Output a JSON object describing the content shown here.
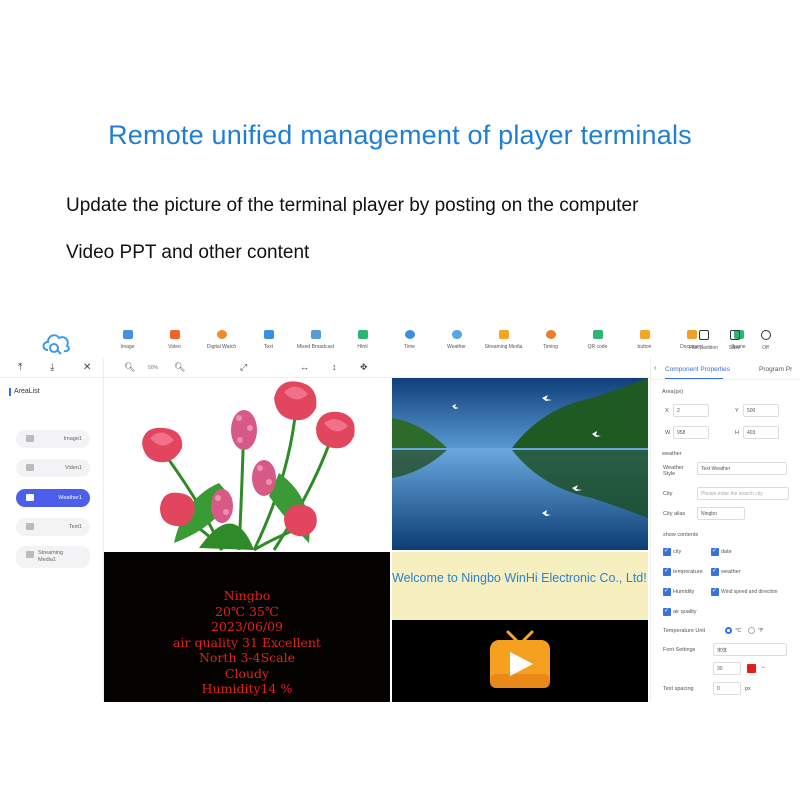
{
  "headline": "Remote unified management of player terminals",
  "subline1": "Update the picture of the terminal player by posting on the computer",
  "subline2": "Video PPT and other content",
  "toolbar": {
    "tools": [
      {
        "label": "Image",
        "color": "#4a90e2"
      },
      {
        "label": "Video",
        "color": "#f0632a"
      },
      {
        "label": "Digital Watch",
        "color": "#f08a2a"
      },
      {
        "label": "Text",
        "color": "#3a8fe0"
      },
      {
        "label": "Mixed Broadcast",
        "color": "#5b9bd5"
      },
      {
        "label": "Html",
        "color": "#2bb673"
      },
      {
        "label": "Time",
        "color": "#3a8fe0"
      },
      {
        "label": "Weather",
        "color": "#58a6e8"
      },
      {
        "label": "Streaming Media",
        "color": "#f5a623"
      },
      {
        "label": "Timing",
        "color": "#f07c2a"
      },
      {
        "label": "QR code",
        "color": "#2bb673"
      },
      {
        "label": "button",
        "color": "#f5a623"
      },
      {
        "label": "Document",
        "color": "#f0a02a"
      },
      {
        "label": "Iframe",
        "color": "#2bb673"
      }
    ],
    "fast_partition": "Fast partition",
    "save": "Save",
    "off": "Off"
  },
  "canvas_toolbar": {
    "zoom": "50%"
  },
  "area_list": {
    "title": "AreaList",
    "items": [
      "Image1",
      "Video1",
      "Weather1",
      "Text1",
      "Streaming Media1"
    ],
    "active_index": 2
  },
  "weather_lines": [
    "Ningbo",
    "20℃ 35℃",
    "2023/06/09",
    "air quality 31 Excellent",
    "North 3-4Scale",
    "Cloudy",
    "Humidity14 %"
  ],
  "welcome_text": "Welcome to Ningbo WinHi Electronic Co., Ltd!",
  "panel": {
    "tabs": [
      "Component Properties",
      "Program Pr"
    ],
    "area_section": "Area(px)",
    "x_label": "X",
    "x_value": "2",
    "y_label": "Y",
    "y_value": "500",
    "w_label": "W",
    "w_value": "958",
    "h_label": "H",
    "h_value": "403",
    "weather_section": "weather",
    "style_label": "Weather Style",
    "style_value": "Text Weather",
    "city_label": "City",
    "city_placeholder": "Please enter the search city",
    "alias_label": "City alias",
    "alias_value": "Ningbo",
    "show_label": "show contents",
    "checks": [
      "city",
      "date",
      "temperature",
      "weather",
      "Humidity",
      "Wind speed and direction",
      "air quality"
    ],
    "unit_label": "Temperature Unit",
    "unit_options": [
      "℃",
      "℉"
    ],
    "font_label": "Font Settings",
    "font_value": "宋体",
    "size_value": "30",
    "font_color": "#e01e1e",
    "spacing_label": "Text spacing",
    "spacing_value": "0",
    "spacing_unit": "px"
  },
  "colors": {
    "accent": "#1f7fd6",
    "active": "#4d5fe9",
    "weather_text": "#e1211b"
  }
}
